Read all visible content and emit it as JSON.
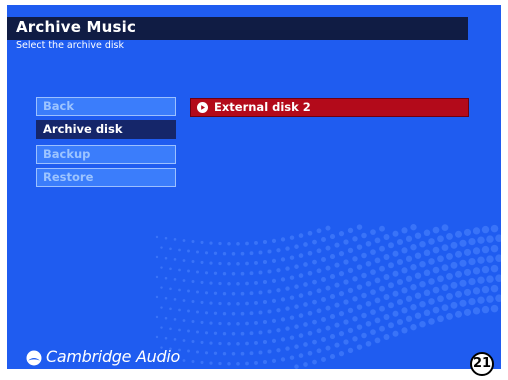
{
  "header": {
    "title": "Archive Music",
    "subtitle": "Select the archive disk"
  },
  "menu": {
    "items": [
      {
        "label": "Back",
        "selected": false
      },
      {
        "label": "Archive disk",
        "selected": true
      },
      {
        "label": "Backup",
        "selected": false
      },
      {
        "label": "Restore",
        "selected": false
      }
    ]
  },
  "disk_list": {
    "items": [
      {
        "label": "External disk 2",
        "icon": "play-circle-icon",
        "highlighted": true
      }
    ]
  },
  "footer": {
    "brand": "Cambridge Audio",
    "logo_icon": "cambridge-audio-logo-icon",
    "page_number": "21"
  },
  "colors": {
    "background": "#1f5cf0",
    "header_bar": "#101c44",
    "menu_item": "#3b7dfb",
    "menu_item_text": "#9cc4ff",
    "menu_selected": "#15266a",
    "disk_highlight": "#b30a1a"
  }
}
